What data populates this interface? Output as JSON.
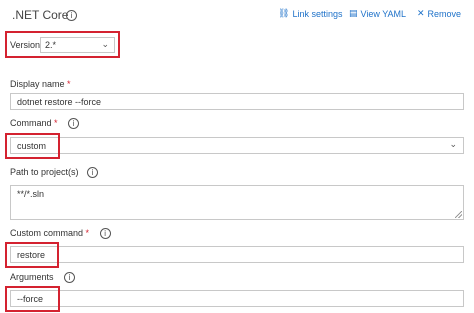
{
  "header": {
    "title": ".NET Core",
    "info_glyph": "i",
    "actions": [
      {
        "icon": "link-icon",
        "label": "Link settings"
      },
      {
        "icon": "yaml-icon",
        "label": "View YAML"
      },
      {
        "icon": "close-icon",
        "label": "Remove"
      }
    ]
  },
  "version": {
    "label": "Version",
    "value": "2.*"
  },
  "display_name": {
    "label": "Display name",
    "required": "*",
    "value": "dotnet restore --force"
  },
  "command": {
    "label": "Command",
    "required": "*",
    "value": "custom"
  },
  "projects": {
    "label": "Path to project(s)",
    "value": "**/*.sln"
  },
  "custom_command": {
    "label": "Custom command",
    "required": "*",
    "value": "restore"
  },
  "arguments": {
    "label": "Arguments",
    "value": "--force"
  },
  "colors": {
    "accent": "#1f72c9",
    "highlight": "#d42230",
    "border": "#c8c8c8"
  }
}
